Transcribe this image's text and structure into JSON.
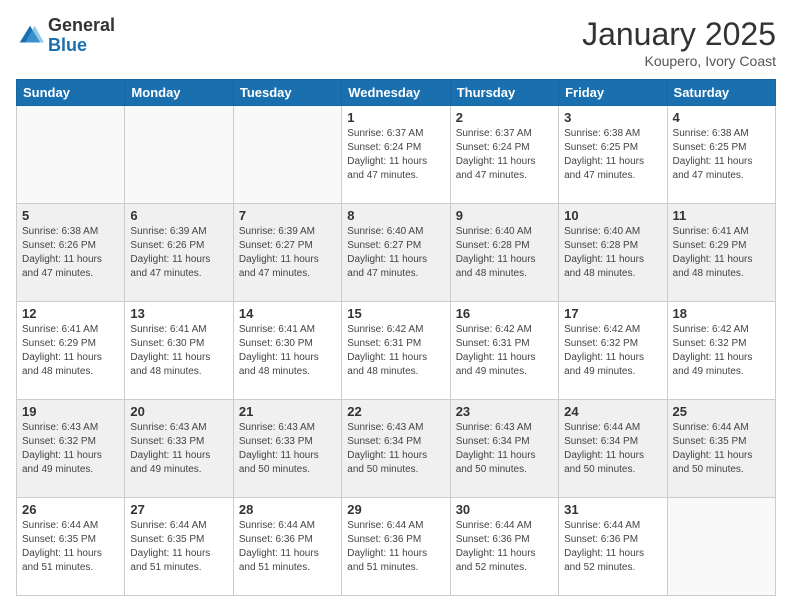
{
  "header": {
    "logo_general": "General",
    "logo_blue": "Blue",
    "month": "January 2025",
    "location": "Koupero, Ivory Coast"
  },
  "weekdays": [
    "Sunday",
    "Monday",
    "Tuesday",
    "Wednesday",
    "Thursday",
    "Friday",
    "Saturday"
  ],
  "weeks": [
    [
      {
        "day": "",
        "info": ""
      },
      {
        "day": "",
        "info": ""
      },
      {
        "day": "",
        "info": ""
      },
      {
        "day": "1",
        "info": "Sunrise: 6:37 AM\nSunset: 6:24 PM\nDaylight: 11 hours\nand 47 minutes."
      },
      {
        "day": "2",
        "info": "Sunrise: 6:37 AM\nSunset: 6:24 PM\nDaylight: 11 hours\nand 47 minutes."
      },
      {
        "day": "3",
        "info": "Sunrise: 6:38 AM\nSunset: 6:25 PM\nDaylight: 11 hours\nand 47 minutes."
      },
      {
        "day": "4",
        "info": "Sunrise: 6:38 AM\nSunset: 6:25 PM\nDaylight: 11 hours\nand 47 minutes."
      }
    ],
    [
      {
        "day": "5",
        "info": "Sunrise: 6:38 AM\nSunset: 6:26 PM\nDaylight: 11 hours\nand 47 minutes."
      },
      {
        "day": "6",
        "info": "Sunrise: 6:39 AM\nSunset: 6:26 PM\nDaylight: 11 hours\nand 47 minutes."
      },
      {
        "day": "7",
        "info": "Sunrise: 6:39 AM\nSunset: 6:27 PM\nDaylight: 11 hours\nand 47 minutes."
      },
      {
        "day": "8",
        "info": "Sunrise: 6:40 AM\nSunset: 6:27 PM\nDaylight: 11 hours\nand 47 minutes."
      },
      {
        "day": "9",
        "info": "Sunrise: 6:40 AM\nSunset: 6:28 PM\nDaylight: 11 hours\nand 48 minutes."
      },
      {
        "day": "10",
        "info": "Sunrise: 6:40 AM\nSunset: 6:28 PM\nDaylight: 11 hours\nand 48 minutes."
      },
      {
        "day": "11",
        "info": "Sunrise: 6:41 AM\nSunset: 6:29 PM\nDaylight: 11 hours\nand 48 minutes."
      }
    ],
    [
      {
        "day": "12",
        "info": "Sunrise: 6:41 AM\nSunset: 6:29 PM\nDaylight: 11 hours\nand 48 minutes."
      },
      {
        "day": "13",
        "info": "Sunrise: 6:41 AM\nSunset: 6:30 PM\nDaylight: 11 hours\nand 48 minutes."
      },
      {
        "day": "14",
        "info": "Sunrise: 6:41 AM\nSunset: 6:30 PM\nDaylight: 11 hours\nand 48 minutes."
      },
      {
        "day": "15",
        "info": "Sunrise: 6:42 AM\nSunset: 6:31 PM\nDaylight: 11 hours\nand 48 minutes."
      },
      {
        "day": "16",
        "info": "Sunrise: 6:42 AM\nSunset: 6:31 PM\nDaylight: 11 hours\nand 49 minutes."
      },
      {
        "day": "17",
        "info": "Sunrise: 6:42 AM\nSunset: 6:32 PM\nDaylight: 11 hours\nand 49 minutes."
      },
      {
        "day": "18",
        "info": "Sunrise: 6:42 AM\nSunset: 6:32 PM\nDaylight: 11 hours\nand 49 minutes."
      }
    ],
    [
      {
        "day": "19",
        "info": "Sunrise: 6:43 AM\nSunset: 6:32 PM\nDaylight: 11 hours\nand 49 minutes."
      },
      {
        "day": "20",
        "info": "Sunrise: 6:43 AM\nSunset: 6:33 PM\nDaylight: 11 hours\nand 49 minutes."
      },
      {
        "day": "21",
        "info": "Sunrise: 6:43 AM\nSunset: 6:33 PM\nDaylight: 11 hours\nand 50 minutes."
      },
      {
        "day": "22",
        "info": "Sunrise: 6:43 AM\nSunset: 6:34 PM\nDaylight: 11 hours\nand 50 minutes."
      },
      {
        "day": "23",
        "info": "Sunrise: 6:43 AM\nSunset: 6:34 PM\nDaylight: 11 hours\nand 50 minutes."
      },
      {
        "day": "24",
        "info": "Sunrise: 6:44 AM\nSunset: 6:34 PM\nDaylight: 11 hours\nand 50 minutes."
      },
      {
        "day": "25",
        "info": "Sunrise: 6:44 AM\nSunset: 6:35 PM\nDaylight: 11 hours\nand 50 minutes."
      }
    ],
    [
      {
        "day": "26",
        "info": "Sunrise: 6:44 AM\nSunset: 6:35 PM\nDaylight: 11 hours\nand 51 minutes."
      },
      {
        "day": "27",
        "info": "Sunrise: 6:44 AM\nSunset: 6:35 PM\nDaylight: 11 hours\nand 51 minutes."
      },
      {
        "day": "28",
        "info": "Sunrise: 6:44 AM\nSunset: 6:36 PM\nDaylight: 11 hours\nand 51 minutes."
      },
      {
        "day": "29",
        "info": "Sunrise: 6:44 AM\nSunset: 6:36 PM\nDaylight: 11 hours\nand 51 minutes."
      },
      {
        "day": "30",
        "info": "Sunrise: 6:44 AM\nSunset: 6:36 PM\nDaylight: 11 hours\nand 52 minutes."
      },
      {
        "day": "31",
        "info": "Sunrise: 6:44 AM\nSunset: 6:36 PM\nDaylight: 11 hours\nand 52 minutes."
      },
      {
        "day": "",
        "info": ""
      }
    ]
  ]
}
